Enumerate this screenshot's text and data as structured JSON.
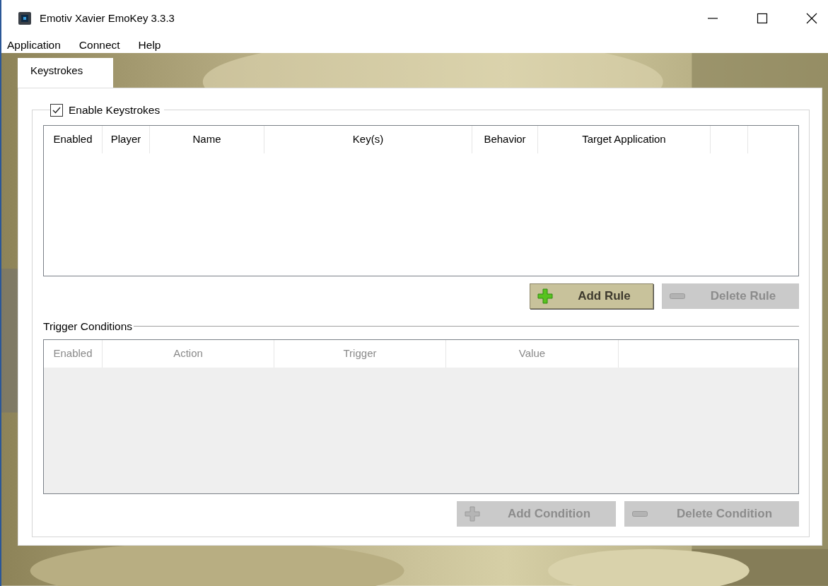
{
  "window": {
    "title": "Emotiv Xavier EmoKey 3.3.3"
  },
  "menu": [
    "Application",
    "Connect",
    "Help"
  ],
  "tabs": [
    {
      "label": "Keystrokes",
      "selected": true
    }
  ],
  "keystrokes": {
    "enable": {
      "label": "Enable Keystrokes",
      "checked": true
    },
    "columns": [
      "Enabled",
      "Player",
      "Name",
      "Key(s)",
      "Behavior",
      "Target Application"
    ],
    "buttons": [
      {
        "label": "Add Rule",
        "kind": "add",
        "disabled": false
      },
      {
        "label": "Delete Rule",
        "kind": "delete",
        "disabled": true
      }
    ]
  },
  "trigger_conditions": {
    "title": "Trigger Conditions",
    "disabled": true,
    "columns": [
      "Enabled",
      "Action",
      "Trigger",
      "Value"
    ],
    "buttons": [
      {
        "label": "Add Condition",
        "kind": "add",
        "disabled": true
      },
      {
        "label": "Delete Condition",
        "kind": "delete",
        "disabled": true
      }
    ]
  }
}
